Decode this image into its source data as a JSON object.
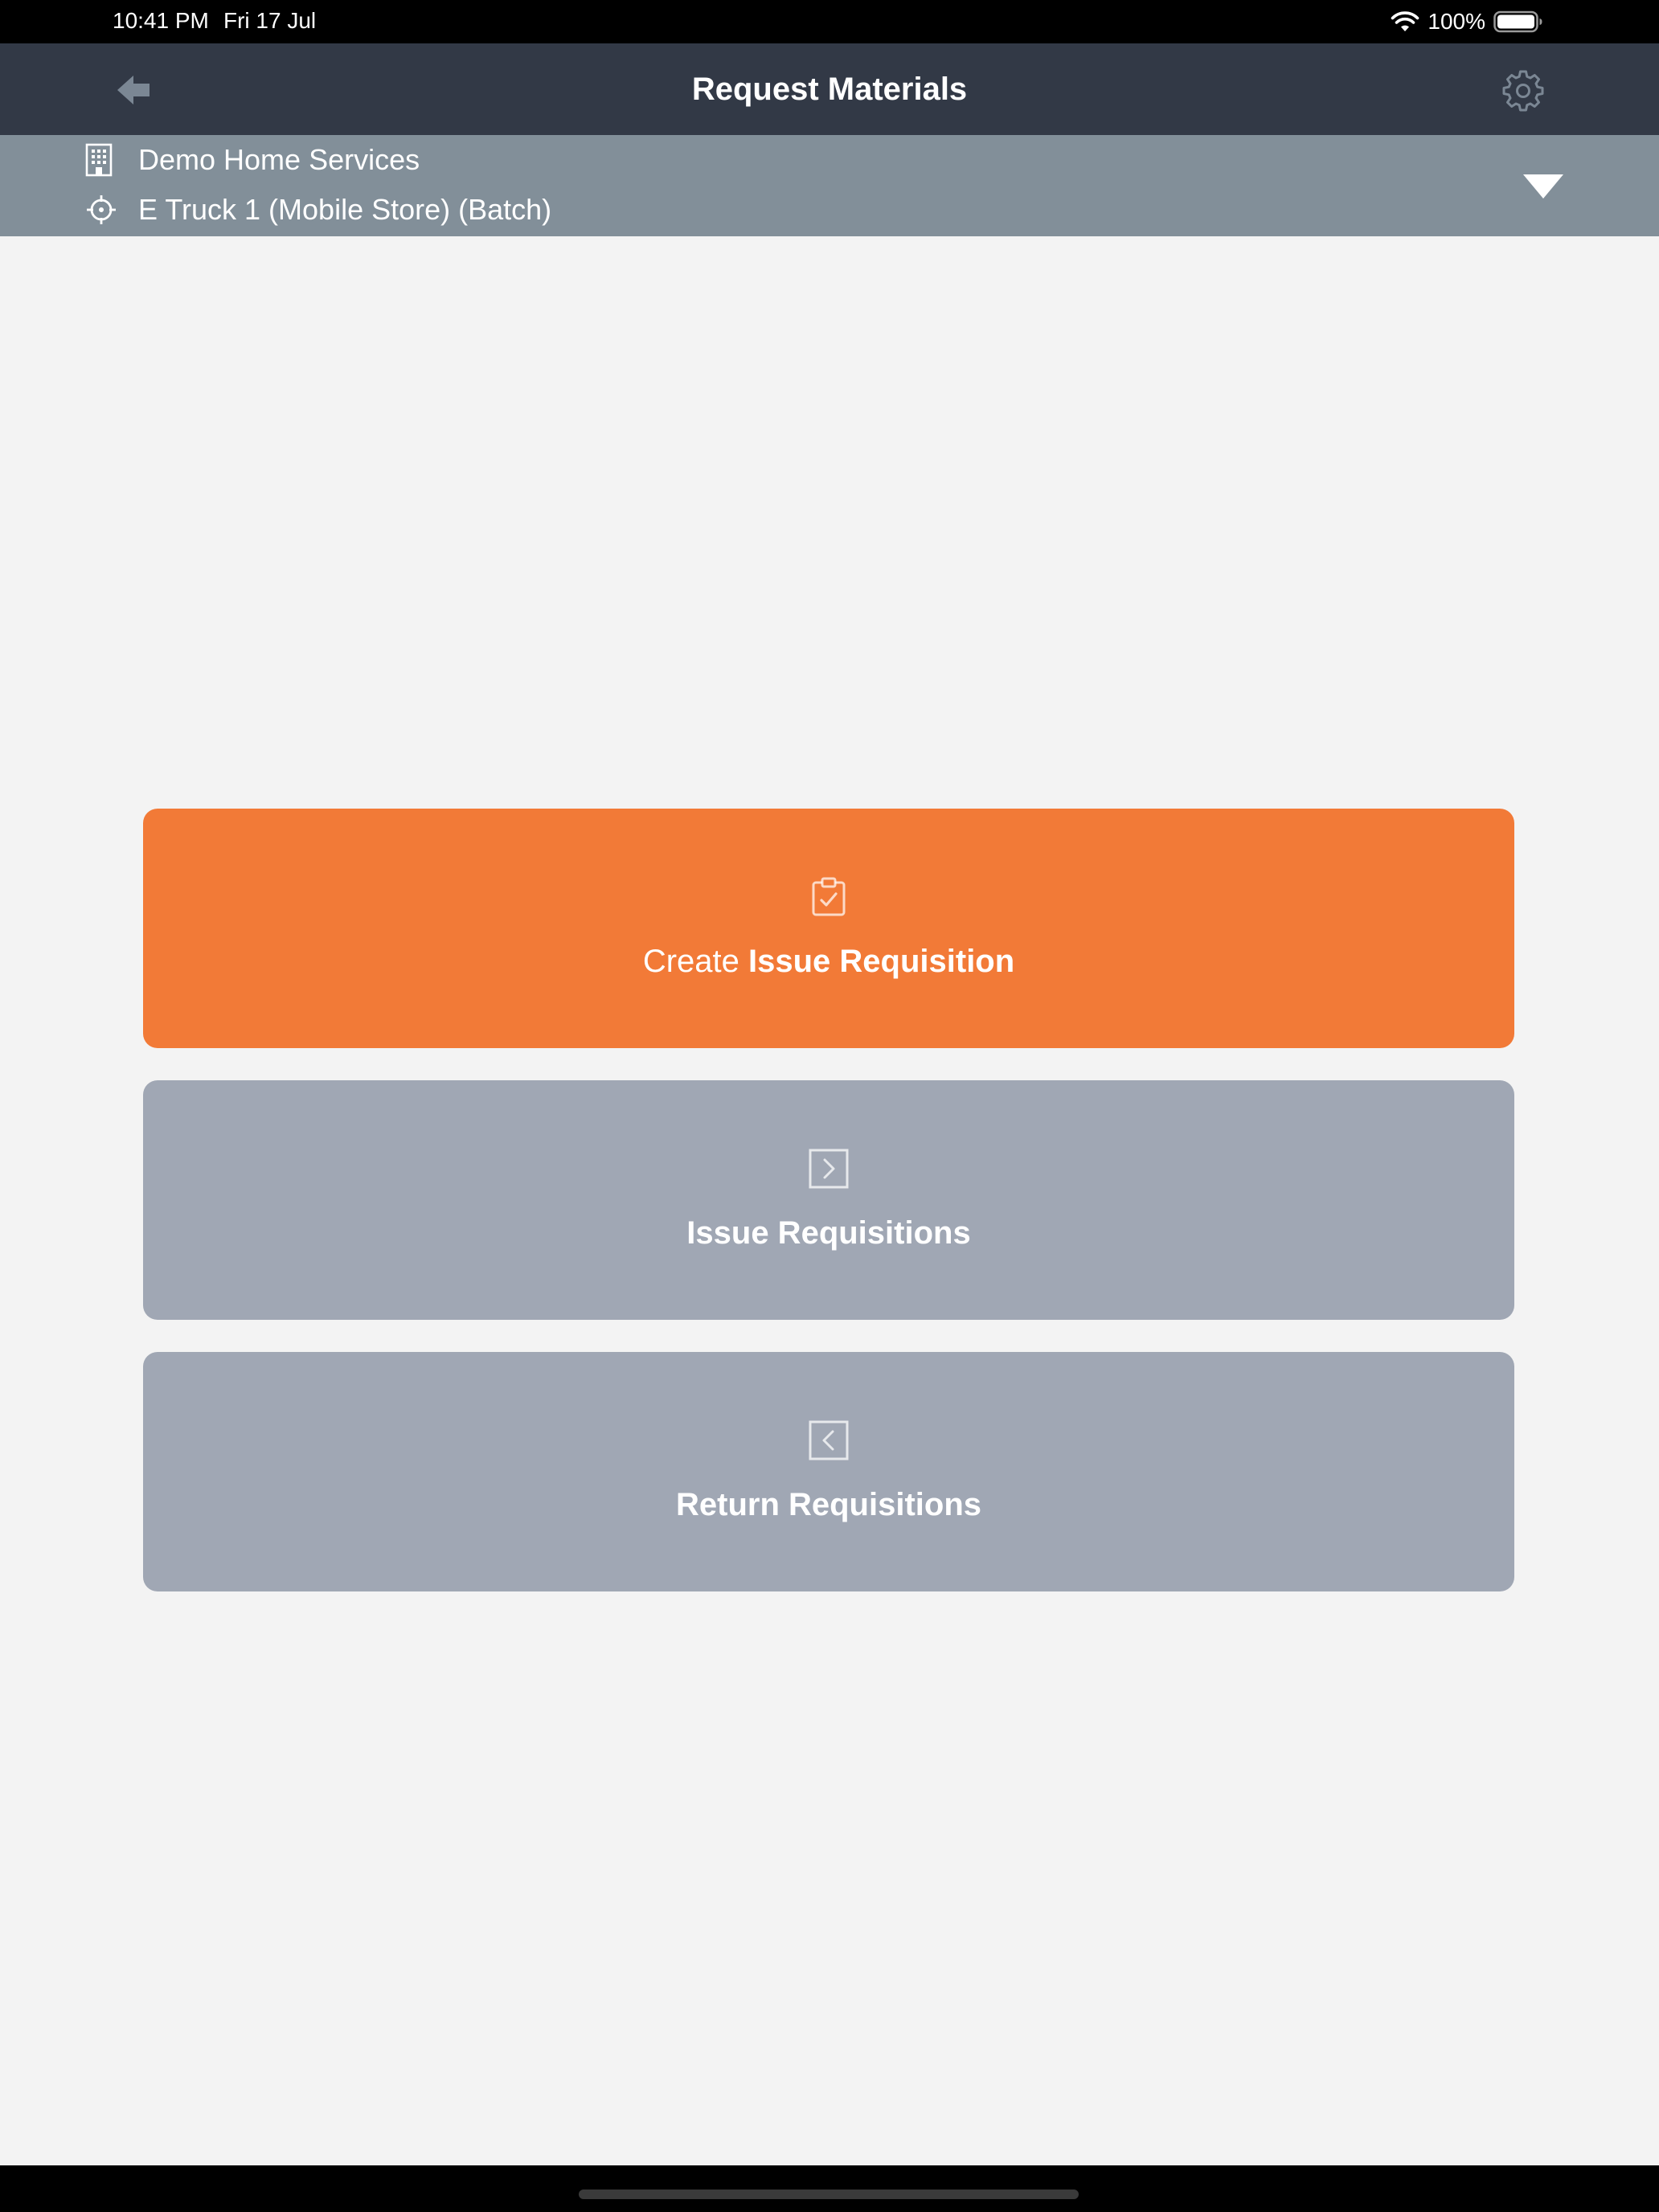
{
  "status_bar": {
    "time": "10:41 PM",
    "date": "Fri 17 Jul",
    "battery": "100%"
  },
  "nav": {
    "title": "Request Materials",
    "back_icon": "arrow-left-icon",
    "settings_icon": "gear-icon"
  },
  "context": {
    "company": "Demo Home Services",
    "location": "E Truck 1 (Mobile Store) (Batch)",
    "company_icon": "building-icon",
    "location_icon": "crosshair-icon",
    "dropdown_icon": "triangle-down-icon"
  },
  "actions": {
    "create": {
      "prefix": "Create",
      "bold": "Issue Requisition",
      "icon": "clipboard-check-icon"
    },
    "issue": {
      "bold": "Issue Requisitions",
      "icon": "chevron-right-square-icon"
    },
    "return": {
      "bold": "Return Requisitions",
      "icon": "chevron-left-square-icon"
    }
  },
  "colors": {
    "status_bar": "#000000",
    "nav_bar": "#323946",
    "context_bar": "#828f99",
    "background": "#f3f3f3",
    "primary_action": "#f27a37",
    "secondary_action": "#a0a7b4"
  }
}
